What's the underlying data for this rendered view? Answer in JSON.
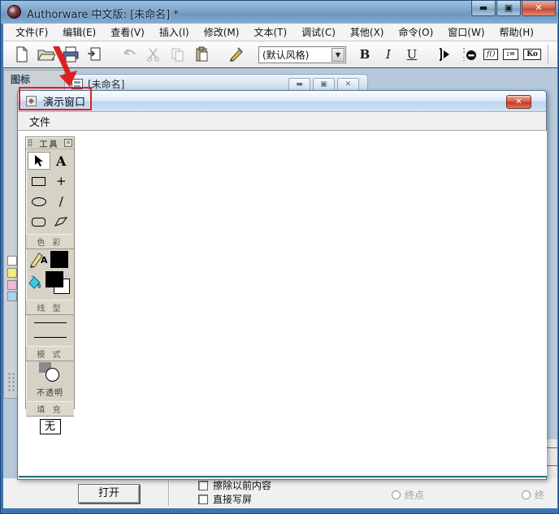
{
  "window": {
    "title": "Authorware 中文版: [未命名] *",
    "minimize_glyph": "▬",
    "restore_glyph": "▣",
    "close_glyph": "✕"
  },
  "menu_bar": {
    "items": [
      "文件(F)",
      "编辑(E)",
      "查看(V)",
      "插入(I)",
      "修改(M)",
      "文本(T)",
      "调试(C)",
      "其他(X)",
      "命令(O)",
      "窗口(W)",
      "帮助(H)"
    ]
  },
  "toolbar": {
    "style_dropdown_value": "(默认风格)",
    "dropdown_arrow": "▼",
    "bold_label": "B",
    "italic_label": "I",
    "underline_label": "U",
    "functions_label": "f()",
    "variables_label": ":=",
    "knowledge_object_label": "Ko"
  },
  "icon_palette": {
    "title": "图标"
  },
  "design_window": {
    "title": "[未命名]",
    "minimize_glyph": "▬",
    "restore_glyph": "▣",
    "close_glyph": "✕"
  },
  "dialog": {
    "title": "演示窗口",
    "close_glyph": "✕",
    "menu_items": [
      "文件"
    ]
  },
  "tool_palette": {
    "title": "工具",
    "close_glyph": "✕",
    "text_tool_label": "A",
    "crosshair_glyph": "+",
    "line_glyph": "/",
    "color_text_label": "A",
    "sections": {
      "colors": "色 彩",
      "line_type": "线 型",
      "mode": "模 式",
      "fill": "填 充"
    },
    "mode_label": "不透明",
    "fill_value": "无"
  },
  "properties_panel": {
    "open_button": "打开",
    "checkbox_erase": "擦除以前内容",
    "checkbox_direct": "直接写屏",
    "radio_endpoint": "终点",
    "radio_endpoint_clipped": "终"
  },
  "colors": {
    "annotation_red": "#e02020",
    "dialog_close_red": "#c03a22",
    "aero_blue": "#7da6cc",
    "palette_beige": "#d6d2c6",
    "bottom_green": "#1f7a4d",
    "swatches": [
      "#ffffff",
      "#f4ee7a",
      "#f6b8d8",
      "#a8d4f0"
    ]
  }
}
